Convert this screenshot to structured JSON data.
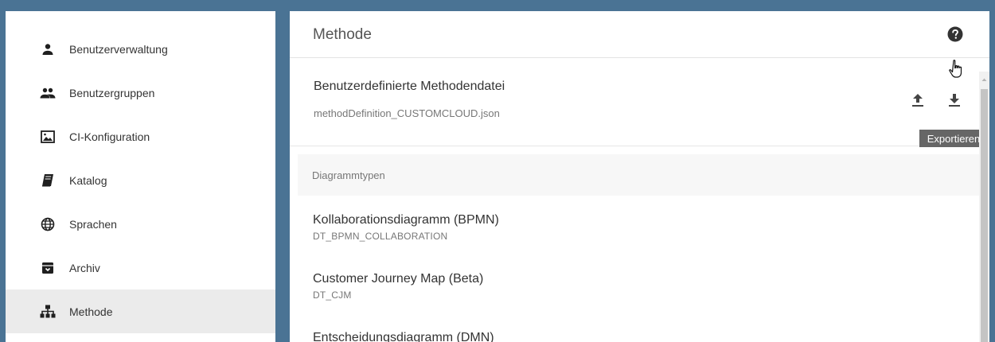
{
  "sidebar": {
    "items": [
      {
        "label": "Benutzerverwaltung",
        "icon": "person-icon",
        "active": false
      },
      {
        "label": "Benutzergruppen",
        "icon": "people-icon",
        "active": false
      },
      {
        "label": "CI-Konfiguration",
        "icon": "image-icon",
        "active": false
      },
      {
        "label": "Katalog",
        "icon": "book-icon",
        "active": false
      },
      {
        "label": "Sprachen",
        "icon": "globe-icon",
        "active": false
      },
      {
        "label": "Archiv",
        "icon": "archive-icon",
        "active": false
      },
      {
        "label": "Methode",
        "icon": "hierarchy-icon",
        "active": true
      }
    ]
  },
  "main": {
    "title": "Methode",
    "file": {
      "title": "Benutzerdefinierte Methodendatei",
      "filename": "methodDefinition_CUSTOMCLOUD.json",
      "tooltip": "Exportieren"
    },
    "section_label": "Diagrammtypen",
    "diagram_types": [
      {
        "name": "Kollaborationsdiagramm (BPMN)",
        "id": "DT_BPMN_COLLABORATION"
      },
      {
        "name": "Customer Journey Map (Beta)",
        "id": "DT_CJM"
      },
      {
        "name": "Entscheidungsdiagramm (DMN)",
        "id": ""
      }
    ]
  },
  "colors": {
    "background": "#4a7394",
    "active_item": "#ebebeb",
    "tooltip": "#666666"
  }
}
